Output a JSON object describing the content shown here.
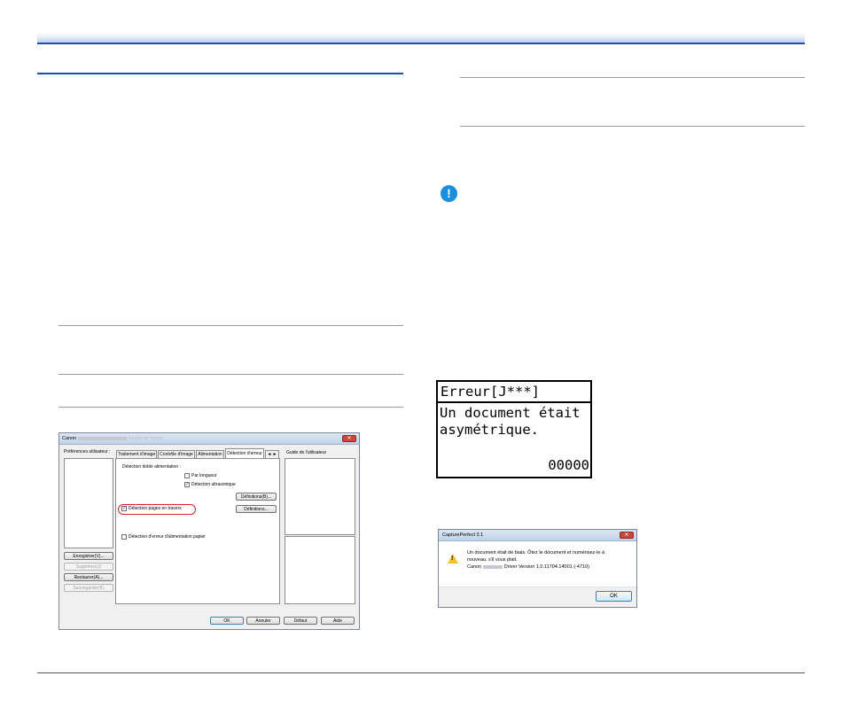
{
  "driver_dialog": {
    "title_prefix": "Canon",
    "title_suffix": "Series on Name",
    "close_glyph": "✕",
    "preferences_label": "Préférences utilisateur :",
    "side_buttons": [
      "Enregistrer(V)...",
      "Supprimer(J)",
      "Restaurer(A)...",
      "Sauvegarder(K)"
    ],
    "tabs": [
      "Traitement d'image",
      "Contrôle d'image",
      "Alimentation",
      "Détection d'erreur",
      "◄ ►"
    ],
    "guide_label": "Guide de l'utilisateur",
    "section_label": "Détection doble alimentation :",
    "option_length": "Par longueur",
    "option_ultrasonic": "Détection ultrasonique",
    "button_defaults": "Définitions(B)...",
    "button_settings": "Définitions...",
    "option_skew": "Détection pages en travers",
    "option_feed_error": "Détection d'erreur d'alimentation papier",
    "footer_buttons": [
      "OK",
      "Annuler",
      "Défaut",
      "Aide"
    ]
  },
  "lcd": {
    "title": "Erreur[J***]",
    "line1": "Un document était",
    "line2": "asymétrique.",
    "code": "00000"
  },
  "message_box": {
    "title": "CapturePerfect 3.1",
    "close_glyph": "✕",
    "line1": "Un document était de biais. Ôtez le document et numérisez-le à",
    "line2": "nouveau, s'il vous plait.",
    "line3_prefix": "Canon",
    "line3_suffix": "Driver Version 1.0.11704.14001 (-4710)",
    "ok_label": "OK"
  },
  "icons": {
    "important": "important-icon",
    "warning": "warning-icon"
  },
  "colors": {
    "accent_blue": "#1d4fb3",
    "important_blue": "#1a8fe0",
    "highlight_red": "#d8232a"
  }
}
